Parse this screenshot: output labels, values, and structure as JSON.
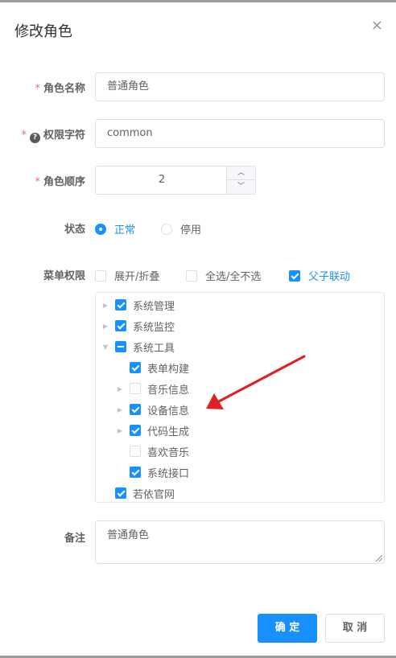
{
  "dialog": {
    "title": "修改角色",
    "close_glyph": "×"
  },
  "form": {
    "required_mark": "*",
    "help_glyph": "?",
    "role_name": {
      "label": "角色名称",
      "value": "普通角色"
    },
    "role_key": {
      "label": "权限字符",
      "value": "common"
    },
    "role_sort": {
      "label": "角色顺序",
      "value": "2",
      "up_glyph": "︿",
      "down_glyph": "﹀"
    },
    "status": {
      "label": "状态",
      "options": [
        "正常",
        "停用"
      ],
      "selected": "正常"
    },
    "menu": {
      "label": "菜单权限",
      "options": [
        {
          "label": "展开/折叠",
          "checked": false
        },
        {
          "label": "全选/全不选",
          "checked": false
        },
        {
          "label": "父子联动",
          "checked": true
        }
      ]
    },
    "remark": {
      "label": "备注",
      "value": "普通角色"
    }
  },
  "tree": [
    {
      "label": "系统管理",
      "state": "checked",
      "level": 0,
      "caret": "▶"
    },
    {
      "label": "系统监控",
      "state": "checked",
      "level": 0,
      "caret": "▶"
    },
    {
      "label": "系统工具",
      "state": "half",
      "level": 0,
      "caret": "▼"
    },
    {
      "label": "表单构建",
      "state": "checked",
      "level": 1,
      "caret": ""
    },
    {
      "label": "音乐信息",
      "state": "unchecked",
      "level": 1,
      "caret": "▶"
    },
    {
      "label": "设备信息",
      "state": "checked",
      "level": 1,
      "caret": "▶"
    },
    {
      "label": "代码生成",
      "state": "checked",
      "level": 1,
      "caret": "▶"
    },
    {
      "label": "喜欢音乐",
      "state": "unchecked",
      "level": 1,
      "caret": ""
    },
    {
      "label": "系统接口",
      "state": "checked",
      "level": 1,
      "caret": ""
    },
    {
      "label": "若依官网",
      "state": "checked",
      "level": 0,
      "caret": ""
    }
  ],
  "buttons": {
    "confirm": "确 定",
    "cancel": "取 消"
  },
  "colors": {
    "primary": "#1890ff",
    "required": "#f56c6c",
    "annotation_arrow": "#e02020"
  }
}
